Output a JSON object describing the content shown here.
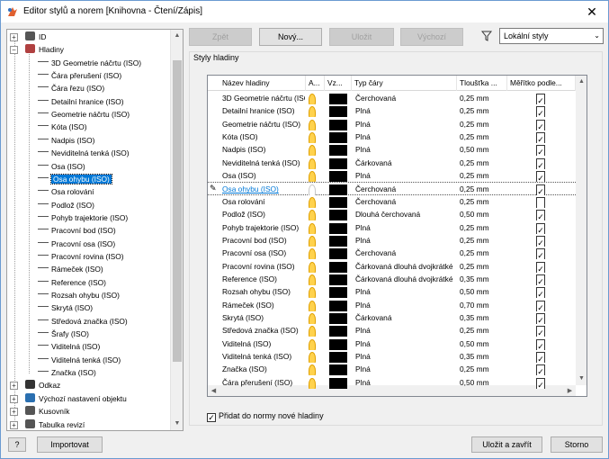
{
  "window": {
    "title": "Editor stylů a norem [Knihovna - Čtení/Zápis]",
    "close_label": "✕"
  },
  "tree": {
    "top_items": [
      {
        "label": "ID",
        "expander": "+"
      },
      {
        "label": "Hladiny",
        "expander": "−"
      }
    ],
    "children": [
      "3D Geometrie náčrtu (ISO)",
      "Čára přerušení (ISO)",
      "Čára řezu (ISO)",
      "Detailní hranice (ISO)",
      "Geometrie náčrtu (ISO)",
      "Kóta (ISO)",
      "Nadpis (ISO)",
      "Neviditelná tenká (ISO)",
      "Osa (ISO)",
      "Osa ohybu (ISO)",
      "Osa rolování",
      "Podlož (ISO)",
      "Pohyb trajektorie (ISO)",
      "Pracovní bod (ISO)",
      "Pracovní osa (ISO)",
      "Pracovní rovina (ISO)",
      "Rámeček (ISO)",
      "Reference (ISO)",
      "Rozsah ohybu (ISO)",
      "Skrytá (ISO)",
      "Středová značka (ISO)",
      "Šrafy (ISO)",
      "Viditelná (ISO)",
      "Viditelná tenká (ISO)",
      "Značka (ISO)"
    ],
    "selected_child": "Osa ohybu (ISO)",
    "bottom_items": [
      {
        "label": "Odkaz",
        "expander": "+"
      },
      {
        "label": "Výchozí nastavení objektu",
        "expander": "+"
      },
      {
        "label": "Kusovník",
        "expander": "+"
      },
      {
        "label": "Tabulka revizí",
        "expander": "+"
      }
    ]
  },
  "toolbar": {
    "back": "Zpět",
    "new": "Nový...",
    "save": "Uložit",
    "default": "Výchozí"
  },
  "filter_combo": {
    "value": "Lokální styly",
    "arrow": "⌄"
  },
  "group_label": "Styly hladiny",
  "grid": {
    "columns": [
      "Název hladiny",
      "A...",
      "Vz...",
      "Typ čáry",
      "Tloušťka ...",
      "Měřítko podle..."
    ],
    "rows": [
      {
        "name": "3D Geometrie náčrtu (ISO)",
        "on": true,
        "type": "Čerchovaná",
        "weight": "0,25 mm",
        "scale": true
      },
      {
        "name": "Detailní hranice (ISO)",
        "on": true,
        "type": "Plná",
        "weight": "0,25 mm",
        "scale": true
      },
      {
        "name": "Geometrie náčrtu (ISO)",
        "on": true,
        "type": "Plná",
        "weight": "0,25 mm",
        "scale": true
      },
      {
        "name": "Kóta (ISO)",
        "on": true,
        "type": "Plná",
        "weight": "0,25 mm",
        "scale": true
      },
      {
        "name": "Nadpis (ISO)",
        "on": true,
        "type": "Plná",
        "weight": "0,50 mm",
        "scale": true
      },
      {
        "name": "Neviditelná tenká (ISO)",
        "on": true,
        "type": "Čárkovaná",
        "weight": "0,25 mm",
        "scale": true
      },
      {
        "name": "Osa (ISO)",
        "on": true,
        "type": "Plná",
        "weight": "0,25 mm",
        "scale": true
      },
      {
        "name": "Osa ohybu (ISO)",
        "on": false,
        "type": "Čerchovaná",
        "weight": "0,25 mm",
        "scale": true,
        "editing": true
      },
      {
        "name": "Osa rolování",
        "on": true,
        "type": "Čerchovaná",
        "weight": "0,25 mm",
        "scale": false
      },
      {
        "name": "Podlož (ISO)",
        "on": true,
        "type": "Dlouhá čerchovaná",
        "weight": "0,50 mm",
        "scale": true
      },
      {
        "name": "Pohyb trajektorie (ISO)",
        "on": true,
        "type": "Plná",
        "weight": "0,25 mm",
        "scale": true
      },
      {
        "name": "Pracovní bod (ISO)",
        "on": true,
        "type": "Plná",
        "weight": "0,25 mm",
        "scale": true
      },
      {
        "name": "Pracovní osa (ISO)",
        "on": true,
        "type": "Čerchovaná",
        "weight": "0,25 mm",
        "scale": true
      },
      {
        "name": "Pracovní rovina (ISO)",
        "on": true,
        "type": "Čárkovaná dlouhá dvojkrátké",
        "weight": "0,25 mm",
        "scale": true
      },
      {
        "name": "Reference (ISO)",
        "on": true,
        "type": "Čárkovaná dlouhá dvojkrátké",
        "weight": "0,35 mm",
        "scale": true
      },
      {
        "name": "Rozsah ohybu (ISO)",
        "on": true,
        "type": "Plná",
        "weight": "0,50 mm",
        "scale": true
      },
      {
        "name": "Rámeček (ISO)",
        "on": true,
        "type": "Plná",
        "weight": "0,70 mm",
        "scale": true
      },
      {
        "name": "Skrytá (ISO)",
        "on": true,
        "type": "Čárkovaná",
        "weight": "0,35 mm",
        "scale": true
      },
      {
        "name": "Středová značka (ISO)",
        "on": true,
        "type": "Plná",
        "weight": "0,25 mm",
        "scale": true
      },
      {
        "name": "Viditelná (ISO)",
        "on": true,
        "type": "Plná",
        "weight": "0,50 mm",
        "scale": true
      },
      {
        "name": "Viditelná tenká (ISO)",
        "on": true,
        "type": "Plná",
        "weight": "0,35 mm",
        "scale": true
      },
      {
        "name": "Značka (ISO)",
        "on": true,
        "type": "Plná",
        "weight": "0,25 mm",
        "scale": true
      },
      {
        "name": "Čára přerušení (ISO)",
        "on": true,
        "type": "Plná",
        "weight": "0,50 mm",
        "scale": true
      }
    ],
    "swatch_color": "#000000"
  },
  "add_layers_checkbox": {
    "label": "Přidat do normy nové hladiny",
    "checked": true
  },
  "footer": {
    "help": "?",
    "import": "Importovat",
    "save_close": "Uložit a zavřít",
    "cancel": "Storno"
  },
  "colors": {
    "accent": "#0078d7",
    "bulb_on": "#ffd24d"
  }
}
